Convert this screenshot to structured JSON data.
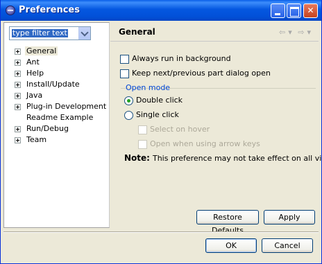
{
  "window": {
    "title": "Preferences"
  },
  "filter": {
    "value": "type filter text"
  },
  "tree": {
    "items": [
      {
        "label": "General",
        "expandable": true,
        "selected": true
      },
      {
        "label": "Ant",
        "expandable": true
      },
      {
        "label": "Help",
        "expandable": true
      },
      {
        "label": "Install/Update",
        "expandable": true
      },
      {
        "label": "Java",
        "expandable": true
      },
      {
        "label": "Plug-in Development",
        "expandable": true
      },
      {
        "label": "Readme Example",
        "expandable": false
      },
      {
        "label": "Run/Debug",
        "expandable": true
      },
      {
        "label": "Team",
        "expandable": true
      }
    ]
  },
  "page": {
    "title": "General",
    "options": {
      "always_run_background": {
        "label": "Always run in background",
        "checked": false
      },
      "keep_next_previous": {
        "label": "Keep next/previous part dialog open",
        "checked": false
      }
    },
    "open_mode": {
      "group_label": "Open mode",
      "double_click": {
        "label": "Double click",
        "selected": true
      },
      "single_click": {
        "label": "Single click",
        "selected": false
      },
      "select_on_hover": {
        "label": "Select on hover",
        "enabled": false
      },
      "open_arrow_keys": {
        "label": "Open when using arrow keys",
        "enabled": false
      }
    },
    "note": {
      "label": "Note:",
      "text": "This preference may not take effect on all views"
    },
    "buttons": {
      "restore_defaults": "Restore Defaults",
      "apply": "Apply"
    }
  },
  "dialog": {
    "ok": "OK",
    "cancel": "Cancel"
  },
  "icons": {
    "back": "back-arrow-icon",
    "forward": "forward-arrow-icon",
    "dropdown": "chevron-down-icon",
    "expander": "plus-expander-icon"
  },
  "colors": {
    "titlebar": "#0054e3",
    "window_bg": "#ece9d8",
    "selection": "#316ac5",
    "group_label": "#0046d5",
    "radio_dot": "#21a121"
  }
}
